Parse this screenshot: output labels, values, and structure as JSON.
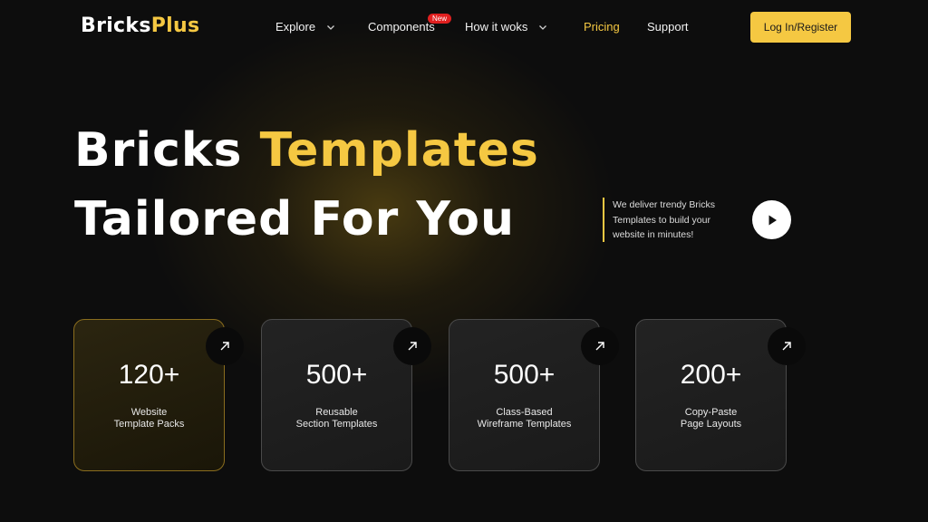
{
  "brand": {
    "name_part1": "Bricks",
    "name_part2": "Plus"
  },
  "nav": {
    "items": [
      {
        "label": "Explore",
        "has_dropdown": true
      },
      {
        "label": "Components",
        "badge": "New"
      },
      {
        "label": "How it woks",
        "has_dropdown": true
      },
      {
        "label": "Pricing",
        "active": true
      },
      {
        "label": "Support"
      }
    ],
    "cta_label": "Log In/Register"
  },
  "hero": {
    "line1_white": "Bricks",
    "line1_accent": "Templates",
    "line2": "Tailored For You",
    "tagline_lines": [
      "We deliver trendy Bricks",
      "Templates to build your",
      "website in minutes!"
    ]
  },
  "cards": [
    {
      "number": "120+",
      "line1": "Website",
      "line2": "Template Packs"
    },
    {
      "number": "500+",
      "line1": "Reusable",
      "line2": "Section Templates"
    },
    {
      "number": "500+",
      "line1": "Class-Based",
      "line2": "Wireframe Templates"
    },
    {
      "number": "200+",
      "line1": "Copy-Paste",
      "line2": "Page Layouts"
    }
  ],
  "colors": {
    "accent": "#f5c842",
    "background": "#0d0d0d",
    "badge": "#e02020"
  },
  "icons": {
    "play": "play-icon",
    "arrow": "arrow-up-right-icon",
    "dropdown": "chevron-down-icon"
  }
}
